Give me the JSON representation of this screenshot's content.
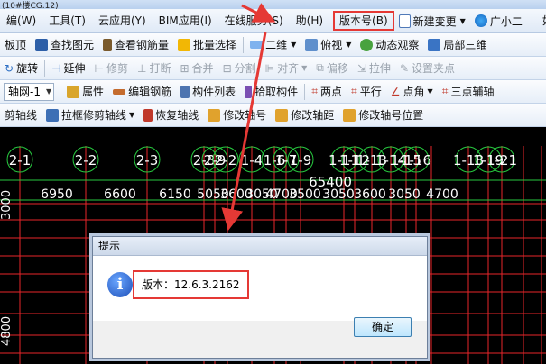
{
  "window": {
    "title": "(10#楼CG.12)"
  },
  "menu": {
    "items": [
      "编(W)",
      "工具(T)",
      "云应用(Y)",
      "BIM应用(I)",
      "在线服务(S)",
      "助(H)"
    ],
    "version": "版本号(B)",
    "new_change": "新建变更",
    "assistant": "广小二",
    "extra": "如何"
  },
  "toolbar1": {
    "items": [
      "板顶",
      "查找图元",
      "查看钢筋量",
      "批量选择"
    ],
    "view_2d": "二维",
    "view_top": "俯视",
    "items2": [
      "动态观察",
      "局部三维"
    ]
  },
  "toolbar2": {
    "items": [
      "旋转",
      "延伸",
      "修剪",
      "打断",
      "合并",
      "分割",
      "对齐",
      "偏移",
      "拉伸",
      "设置夹点"
    ]
  },
  "toolbar3": {
    "layer_select": "轴网-1",
    "items": [
      "属性",
      "编辑钢筋",
      "构件列表",
      "拾取构件",
      "两点",
      "平行",
      "点角",
      "三点辅轴"
    ]
  },
  "toolbar4": {
    "items": [
      "剪轴线",
      "拉框修剪轴线",
      "恢复轴线",
      "修改轴号",
      "修改轴距",
      "修改轴号位置"
    ]
  },
  "canvas": {
    "axis_labels": [
      "2-1",
      "2-2",
      "2-3",
      "2-8",
      "2-9",
      "2-2",
      "1-4",
      "1-6",
      "1-7",
      "1-9",
      "1-11",
      "1-12",
      "1-13",
      "1-14",
      "1-15",
      "1-16",
      "1-18",
      "1-19",
      "1-21"
    ],
    "total_dim": "65400",
    "dims": [
      "6950",
      "6600",
      "6150",
      "5050",
      "3600",
      "3050",
      "4700",
      "3500",
      "3050",
      "3600",
      "3050",
      "4700"
    ],
    "side_dims": [
      "3000",
      "4800"
    ]
  },
  "dialog": {
    "title": "提示",
    "message": "版本：12.6.3.2162",
    "ok": "确定"
  }
}
